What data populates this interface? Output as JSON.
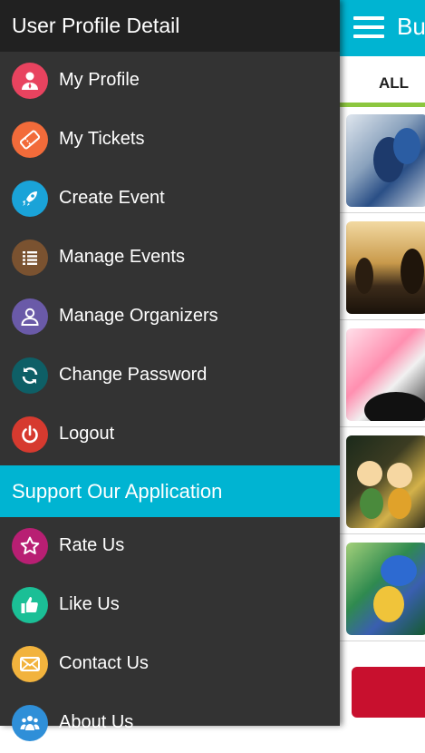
{
  "app": {
    "title": "Bu",
    "tab_all": "ALL",
    "accent_color": "#00b4d2",
    "tab_indicator_color": "#8cc63f",
    "event_thumbnails": [
      "counter-strike-image",
      "sunset-palm-image",
      "party-crowd-image",
      "cartoon-kids-image",
      "parrot-cartoon-image"
    ]
  },
  "drawer": {
    "header_title": "User Profile Detail",
    "items": [
      {
        "label": "My Profile",
        "icon": "user-icon",
        "color": "#e8435f"
      },
      {
        "label": "My Tickets",
        "icon": "ticket-icon",
        "color": "#f26b3a"
      },
      {
        "label": "Create Event",
        "icon": "rocket-icon",
        "color": "#1aa3d8"
      },
      {
        "label": "Manage Events",
        "icon": "list-icon",
        "color": "#7a5230"
      },
      {
        "label": "Manage Organizers",
        "icon": "organizer-icon",
        "color": "#6a5aa8"
      },
      {
        "label": "Change Password",
        "icon": "refresh-icon",
        "color": "#0e5f66"
      },
      {
        "label": "Logout",
        "icon": "power-icon",
        "color": "#d63a2f"
      }
    ],
    "support_title": "Support Our Application",
    "support_items": [
      {
        "label": "Rate Us",
        "icon": "star-icon",
        "color": "#b81f73"
      },
      {
        "label": "Like Us",
        "icon": "thumbs-up-icon",
        "color": "#1bbf96"
      },
      {
        "label": "Contact Us",
        "icon": "mail-icon",
        "color": "#f2b33d"
      },
      {
        "label": "About Us",
        "icon": "group-icon",
        "color": "#2f8fd8"
      }
    ]
  }
}
